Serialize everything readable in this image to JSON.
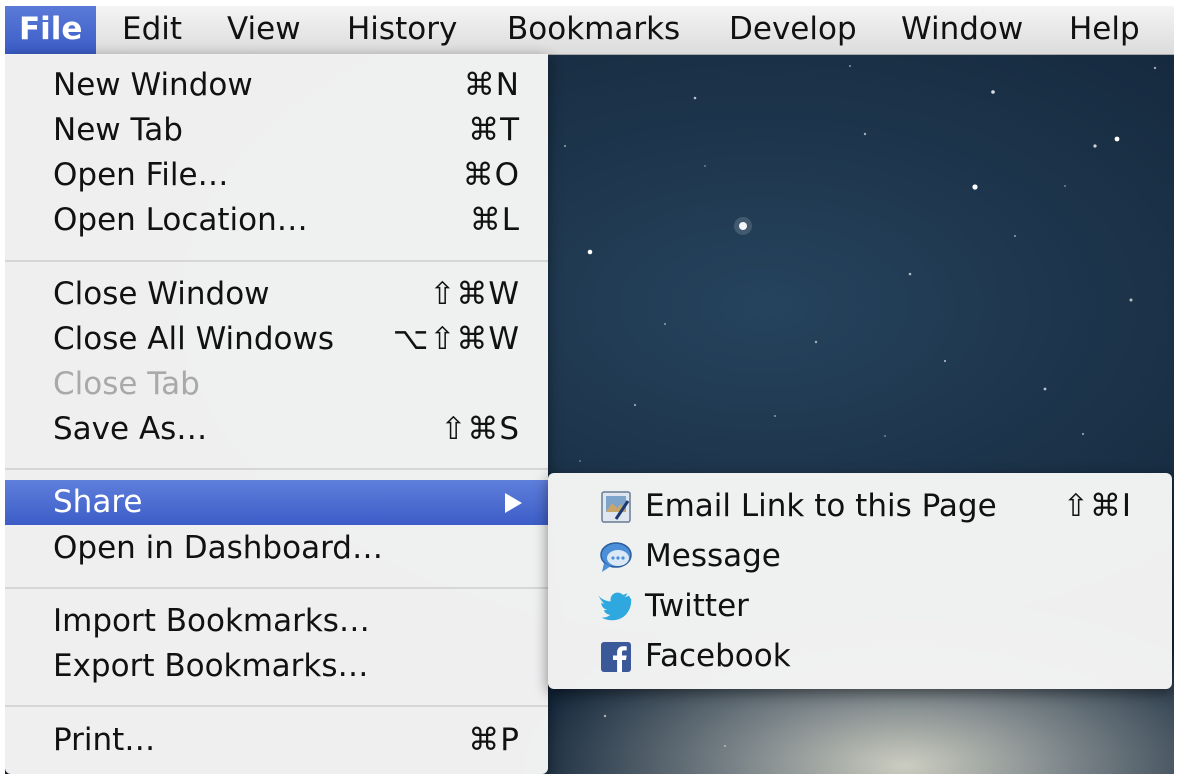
{
  "menubar": {
    "items": [
      {
        "label": "File",
        "active": true
      },
      {
        "label": "Edit"
      },
      {
        "label": "View"
      },
      {
        "label": "History"
      },
      {
        "label": "Bookmarks"
      },
      {
        "label": "Develop"
      },
      {
        "label": "Window"
      },
      {
        "label": "Help"
      }
    ]
  },
  "file_menu": {
    "items": [
      {
        "label": "New Window",
        "shortcut": "⌘N"
      },
      {
        "label": "New Tab",
        "shortcut": "⌘T"
      },
      {
        "label": "Open File…",
        "shortcut": "⌘O"
      },
      {
        "label": "Open Location…",
        "shortcut": "⌘L"
      },
      {
        "label": "Close Window",
        "shortcut": "⇧⌘W"
      },
      {
        "label": "Close All Windows",
        "shortcut": "⌥⇧⌘W"
      },
      {
        "label": "Close Tab",
        "shortcut": "",
        "disabled": true
      },
      {
        "label": "Save As…",
        "shortcut": "⇧⌘S"
      },
      {
        "label": "Share",
        "submenu": true,
        "highlighted": true
      },
      {
        "label": "Open in Dashboard…",
        "shortcut": ""
      },
      {
        "label": "Import Bookmarks…",
        "shortcut": ""
      },
      {
        "label": "Export Bookmarks…",
        "shortcut": ""
      },
      {
        "label": "Print…",
        "shortcut": "⌘P"
      }
    ]
  },
  "share_menu": {
    "items": [
      {
        "label": "Email Link to this Page",
        "shortcut": "⇧⌘I",
        "icon": "mail-icon"
      },
      {
        "label": "Message",
        "icon": "message-bubble-icon"
      },
      {
        "label": "Twitter",
        "icon": "twitter-bird-icon"
      },
      {
        "label": "Facebook",
        "icon": "facebook-icon"
      }
    ]
  },
  "colors": {
    "highlight": "#3c5dc7",
    "disabled_text": "#a9a9a9",
    "facebook": "#3b5998",
    "twitter": "#2fa8e0"
  }
}
